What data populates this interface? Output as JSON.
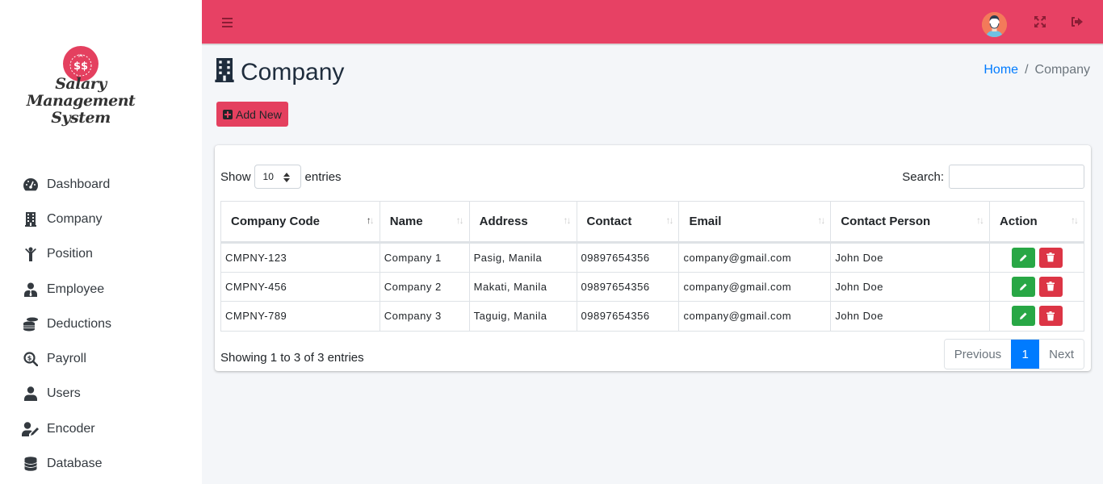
{
  "app": {
    "brand_line1": "Salary Management",
    "brand_line2": "System",
    "accent_color": "#e74164"
  },
  "sidebar": {
    "items": [
      {
        "label": "Dashboard",
        "icon": "dashboard-gauge-icon"
      },
      {
        "label": "Company",
        "icon": "building-icon"
      },
      {
        "label": "Position",
        "icon": "person-raised-arms-icon"
      },
      {
        "label": "Employee",
        "icon": "user-tie-icon"
      },
      {
        "label": "Deductions",
        "icon": "coins-icon"
      },
      {
        "label": "Payroll",
        "icon": "search-dollar-icon"
      },
      {
        "label": "Users",
        "icon": "user-icon"
      },
      {
        "label": "Encoder",
        "icon": "user-edit-icon"
      },
      {
        "label": "Database",
        "icon": "database-icon"
      }
    ]
  },
  "topbar": {
    "menu_icon": "hamburger-icon",
    "avatar_icon": "avatar-icon",
    "fullscreen_icon": "expand-icon",
    "logout_icon": "sign-out-icon"
  },
  "header": {
    "title": "Company",
    "title_icon": "building-icon",
    "breadcrumb": {
      "home": "Home",
      "separator": "/",
      "current": "Company"
    },
    "add_button": "Add New"
  },
  "table_controls": {
    "show_label": "Show",
    "entries_label": "entries",
    "page_length": "10",
    "search_label": "Search:",
    "search_value": ""
  },
  "table": {
    "columns": [
      "Company Code",
      "Name",
      "Address",
      "Contact",
      "Email",
      "Contact Person",
      "Action"
    ],
    "rows": [
      {
        "code": "CMPNY-123",
        "name": "Company 1",
        "address": "Pasig, Manila",
        "contact": "09897654356",
        "email": "company@gmail.com",
        "person": "John Doe"
      },
      {
        "code": "CMPNY-456",
        "name": "Company 2",
        "address": "Makati, Manila",
        "contact": "09897654356",
        "email": "company@gmail.com",
        "person": "John Doe"
      },
      {
        "code": "CMPNY-789",
        "name": "Company 3",
        "address": "Taguig, Manila",
        "contact": "09897654356",
        "email": "company@gmail.com",
        "person": "John Doe"
      }
    ]
  },
  "footer": {
    "info": "Showing 1 to 3 of 3 entries",
    "previous": "Previous",
    "current_page": "1",
    "next": "Next"
  }
}
